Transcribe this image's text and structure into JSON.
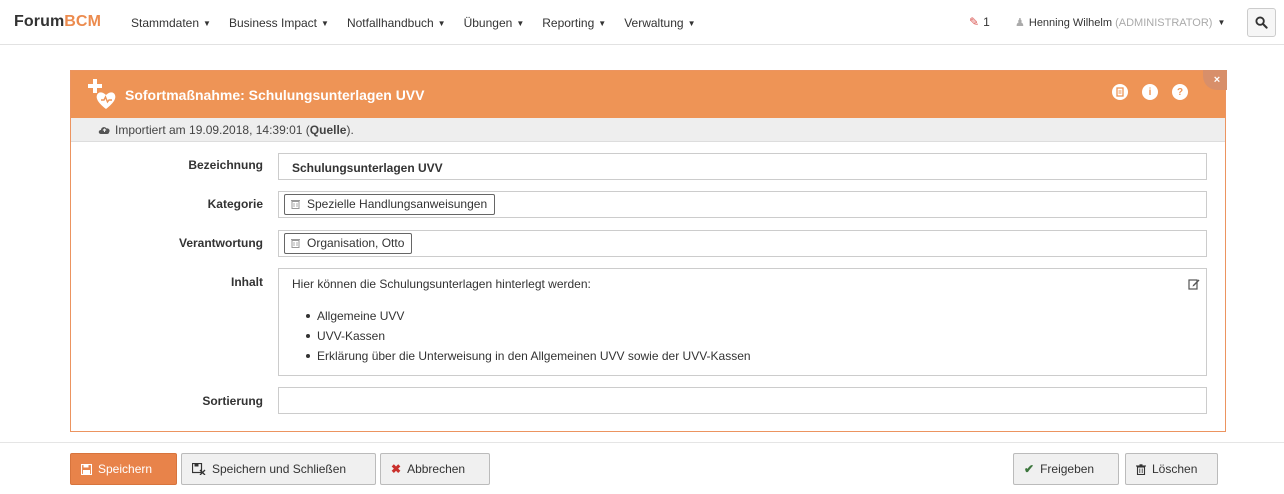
{
  "brand": {
    "part1": "Forum",
    "part2": "BCM"
  },
  "nav": {
    "items": [
      {
        "label": "Stammdaten"
      },
      {
        "label": "Business Impact"
      },
      {
        "label": "Notfallhandbuch"
      },
      {
        "label": "Übungen"
      },
      {
        "label": "Reporting"
      },
      {
        "label": "Verwaltung"
      }
    ],
    "notification_count": "1",
    "user_name": "Henning Wilhelm",
    "user_role": "(ADMINISTRATOR)"
  },
  "panel": {
    "title": "Sofortmaßnahme: Schulungsunterlagen UVV",
    "import_prefix": "Importiert am 19.09.2018, 14:39:01 (",
    "import_source": "Quelle",
    "import_suffix": ")."
  },
  "form": {
    "bezeichnung": {
      "label": "Bezeichnung",
      "value": "Schulungsunterlagen UVV"
    },
    "kategorie": {
      "label": "Kategorie",
      "tag": "Spezielle Handlungsanweisungen"
    },
    "verantwortung": {
      "label": "Verantwortung",
      "tag": "Organisation, Otto"
    },
    "inhalt": {
      "label": "Inhalt",
      "intro": "Hier können die Schulungsunterlagen hinterlegt werden:",
      "items": [
        "Allgemeine UVV",
        "UVV-Kassen",
        "Erklärung über die Unterweisung in den Allgemeinen UVV sowie der UVV-Kassen"
      ]
    },
    "sortierung": {
      "label": "Sortierung",
      "value": ""
    }
  },
  "footer": {
    "save": "Speichern",
    "save_close": "Speichern und Schließen",
    "cancel": "Abbrechen",
    "release": "Freigeben",
    "delete": "Löschen"
  },
  "colors": {
    "accent": "#ee9456",
    "primary_button": "#e8834a",
    "cancel_x": "#c9302c",
    "release_check": "#3c763d"
  },
  "icons": [
    "search-icon",
    "pencil-icon",
    "user-icon",
    "medical-heart-icon",
    "pdf-icon",
    "info-icon",
    "help-icon",
    "close-icon",
    "cloud-icon",
    "trash-icon",
    "edit-icon",
    "floppy-icon",
    "save-close-icon",
    "x-icon",
    "check-icon"
  ]
}
